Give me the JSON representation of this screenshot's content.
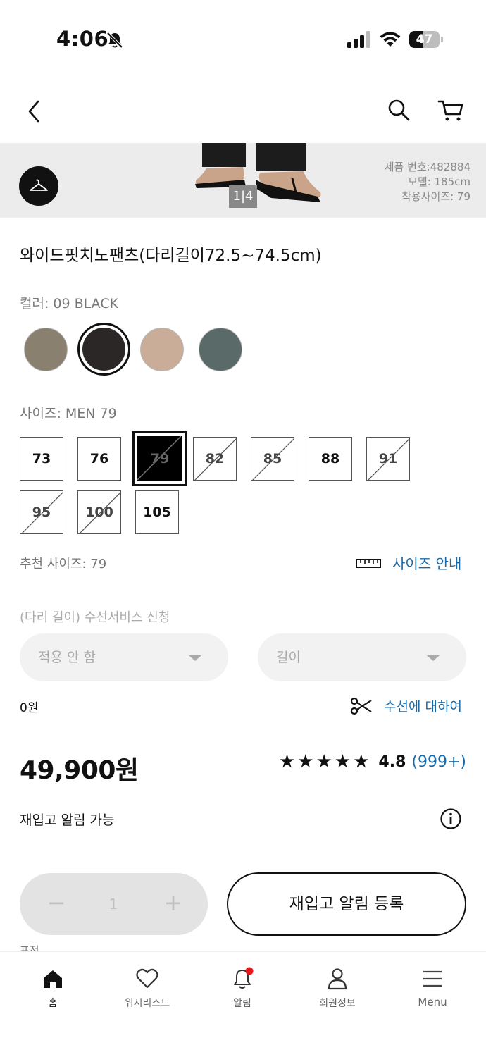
{
  "status": {
    "time": "4:06",
    "battery": "47",
    "battery_level": 0.47
  },
  "nav": {
    "back": "back",
    "search": "search",
    "cart": "cart"
  },
  "hero": {
    "counter": "1|4",
    "product_no": "제품 번호:482884",
    "model": "모델: 185cm",
    "wear_size": "착용사이즈: 79"
  },
  "product": {
    "title": "와이드핏치노팬츠(다리길이72.5~74.5cm)",
    "color_label": "컬러: 09 BLACK",
    "colors": [
      "#8a8070",
      "#2b2727",
      "#c9ad98",
      "#5a6a68"
    ],
    "selected_color_index": 1,
    "size_label": "사이즈: MEN 79",
    "sizes": [
      {
        "label": "73",
        "soldout": false
      },
      {
        "label": "76",
        "soldout": false
      },
      {
        "label": "79",
        "soldout": true,
        "selected": true
      },
      {
        "label": "82",
        "soldout": true
      },
      {
        "label": "85",
        "soldout": true
      },
      {
        "label": "88",
        "soldout": false
      },
      {
        "label": "91",
        "soldout": true
      },
      {
        "label": "95",
        "soldout": true
      },
      {
        "label": "100",
        "soldout": true
      },
      {
        "label": "105",
        "soldout": false
      }
    ],
    "recommended": "추천 사이즈: 79",
    "size_guide": "사이즈 안내",
    "hem_title": "(다리 길이) 수선서비스 신청",
    "hem_option": "적용 안 함",
    "hem_length": "길이",
    "hem_price": "0원",
    "about_hem": "수선에 대하여",
    "price": "49,900원",
    "stars": "★★★★★",
    "rating": 4.8,
    "rating_text": "4.8",
    "review_count": "(999+)",
    "restock_text": "재입고 알림 가능",
    "quantity": "1",
    "quantity_minus": "−",
    "quantity_plus": "+",
    "notify_button": "재입고 알림 등록",
    "peek_text": "표전"
  },
  "tabbar": {
    "items": [
      {
        "label": "홈",
        "icon": "home-icon",
        "active": true
      },
      {
        "label": "위시리스트",
        "icon": "heart-icon"
      },
      {
        "label": "알림",
        "icon": "bell-icon",
        "badge": true
      },
      {
        "label": "회원정보",
        "icon": "user-icon"
      },
      {
        "label": "Menu",
        "icon": "menu-icon"
      }
    ]
  }
}
